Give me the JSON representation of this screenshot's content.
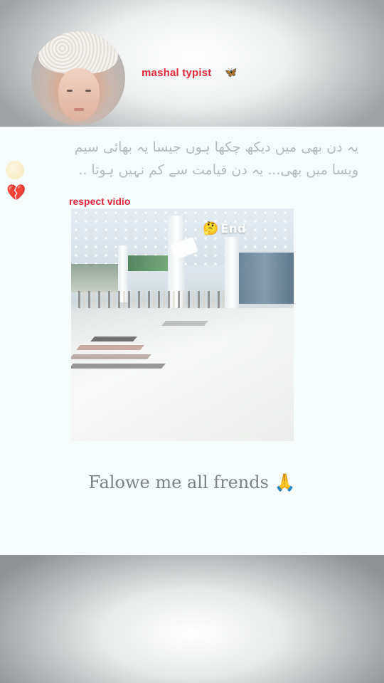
{
  "header": {
    "username": "mashal  typist",
    "username_emoji": "🦋",
    "avatar_icon": "profile-photo"
  },
  "caption": {
    "line1": "یہ دن بھی میں دیکھ چکھا ہوں جیسا یہ بھائی سیم",
    "line2": "ویسا میں بھی... یہ دن قیامت سے کم نہیں ہوتا ..",
    "emoji_heart": "💔"
  },
  "video": {
    "label": "respect vidio",
    "overlay_text": "End",
    "overlay_emoji": "🤔"
  },
  "footer": {
    "text": "Falowe me all frends",
    "emoji": "🙏"
  },
  "colors": {
    "accent_red": "#e0293a",
    "caption_gray": "#b4bbbc",
    "footer_gray": "#7d8283",
    "background": "#f6fbfb"
  }
}
